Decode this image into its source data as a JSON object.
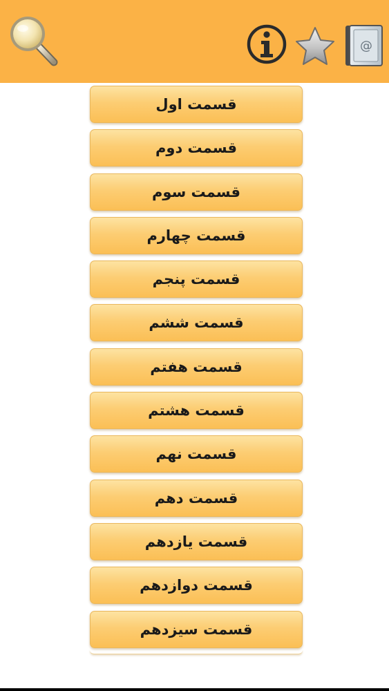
{
  "toolbar": {
    "background": "#fbb246",
    "icons": [
      "search-icon",
      "info-icon",
      "star-icon",
      "contact-book-icon"
    ],
    "contact_symbol": "@"
  },
  "sections": [
    {
      "label": "قسمت اول"
    },
    {
      "label": "قسمت دوم"
    },
    {
      "label": "قسمت سوم"
    },
    {
      "label": "قسمت چهارم"
    },
    {
      "label": "قسمت پنجم"
    },
    {
      "label": "قسمت ششم"
    },
    {
      "label": "قسمت هفتم"
    },
    {
      "label": "قسمت هشتم"
    },
    {
      "label": "قسمت نهم"
    },
    {
      "label": "قسمت دهم"
    },
    {
      "label": "قسمت یازدهم"
    },
    {
      "label": "قسمت دوازدهم"
    },
    {
      "label": "قسمت سیزدهم"
    }
  ]
}
